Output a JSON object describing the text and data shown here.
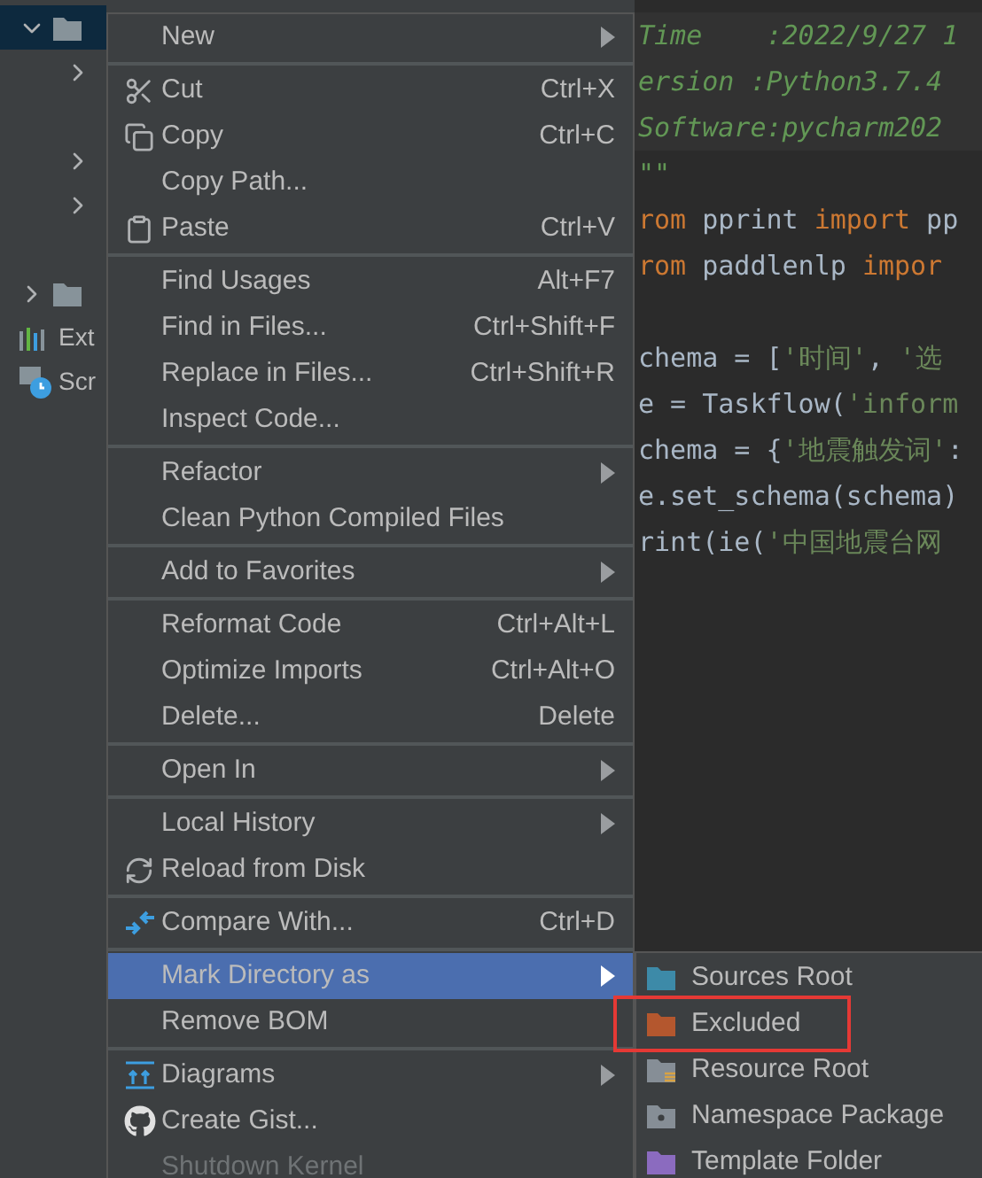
{
  "tree": [
    {
      "kind": "folder",
      "expanded": true,
      "selected": true
    },
    {
      "kind": "chevron",
      "expanded": false,
      "selected": false
    },
    {
      "kind": "blank"
    },
    {
      "kind": "chevron",
      "expanded": false,
      "selected": false
    },
    {
      "kind": "chevron",
      "expanded": false,
      "selected": false
    },
    {
      "kind": "blank"
    },
    {
      "kind": "folder",
      "expanded": false,
      "selected": false
    },
    {
      "kind": "libraries",
      "selected": false,
      "label": "Ext"
    },
    {
      "kind": "scratches",
      "selected": false,
      "label": "Scr"
    }
  ],
  "menu": [
    [
      {
        "label": "New",
        "submenu": true,
        "kind": "plain",
        "selected": false,
        "disabled": false
      }
    ],
    [
      {
        "label": "Cut",
        "shortcut": "Ctrl+X",
        "submenu": false,
        "kind": "cut",
        "selected": false,
        "disabled": false
      },
      {
        "label": "Copy",
        "shortcut": "Ctrl+C",
        "submenu": false,
        "kind": "copy",
        "selected": false,
        "disabled": false
      },
      {
        "label": "Copy Path...",
        "submenu": false,
        "kind": "plain",
        "selected": false,
        "disabled": false
      },
      {
        "label": "Paste",
        "shortcut": "Ctrl+V",
        "submenu": false,
        "kind": "paste",
        "selected": false,
        "disabled": false
      }
    ],
    [
      {
        "label": "Find Usages",
        "shortcut": "Alt+F7",
        "submenu": false,
        "kind": "plain",
        "selected": false,
        "disabled": false
      },
      {
        "label": "Find in Files...",
        "shortcut": "Ctrl+Shift+F",
        "submenu": false,
        "kind": "plain",
        "selected": false,
        "disabled": false
      },
      {
        "label": "Replace in Files...",
        "shortcut": "Ctrl+Shift+R",
        "submenu": false,
        "kind": "plain",
        "selected": false,
        "disabled": false
      },
      {
        "label": "Inspect Code...",
        "submenu": false,
        "kind": "plain",
        "selected": false,
        "disabled": false
      }
    ],
    [
      {
        "label": "Refactor",
        "submenu": true,
        "kind": "plain",
        "selected": false,
        "disabled": false
      },
      {
        "label": "Clean Python Compiled Files",
        "submenu": false,
        "kind": "plain",
        "selected": false,
        "disabled": false
      }
    ],
    [
      {
        "label": "Add to Favorites",
        "submenu": true,
        "kind": "plain",
        "selected": false,
        "disabled": false
      }
    ],
    [
      {
        "label": "Reformat Code",
        "shortcut": "Ctrl+Alt+L",
        "submenu": false,
        "kind": "plain",
        "selected": false,
        "disabled": false
      },
      {
        "label": "Optimize Imports",
        "shortcut": "Ctrl+Alt+O",
        "submenu": false,
        "kind": "plain",
        "selected": false,
        "disabled": false
      },
      {
        "label": "Delete...",
        "shortcut": "Delete",
        "submenu": false,
        "kind": "plain",
        "selected": false,
        "disabled": false
      }
    ],
    [
      {
        "label": "Open In",
        "submenu": true,
        "kind": "plain",
        "selected": false,
        "disabled": false
      }
    ],
    [
      {
        "label": "Local History",
        "submenu": true,
        "kind": "plain",
        "selected": false,
        "disabled": false
      },
      {
        "label": "Reload from Disk",
        "submenu": false,
        "kind": "reload",
        "selected": false,
        "disabled": false
      }
    ],
    [
      {
        "label": "Compare With...",
        "shortcut": "Ctrl+D",
        "submenu": false,
        "kind": "compare",
        "selected": false,
        "disabled": false
      }
    ],
    [
      {
        "label": "Mark Directory as",
        "submenu": true,
        "kind": "plain",
        "selected": true,
        "disabled": false
      },
      {
        "label": "Remove BOM",
        "submenu": false,
        "kind": "plain",
        "selected": false,
        "disabled": false
      }
    ],
    [
      {
        "label": "Diagrams",
        "submenu": true,
        "kind": "diagrams",
        "selected": false,
        "disabled": false
      },
      {
        "label": "Create Gist...",
        "submenu": false,
        "kind": "github",
        "selected": false,
        "disabled": false
      },
      {
        "label": "Shutdown Kernel",
        "submenu": false,
        "kind": "plain",
        "selected": false,
        "disabled": true
      }
    ]
  ],
  "submenu": [
    {
      "label": "Sources Root",
      "kind": "folder",
      "color": "#3d8aa8",
      "highlighted": false
    },
    {
      "label": "Excluded",
      "kind": "folder",
      "color": "#b4572e",
      "highlighted": true
    },
    {
      "label": "Resource Root",
      "kind": "resource",
      "color": "#868e96",
      "highlighted": false
    },
    {
      "label": "Namespace Package",
      "kind": "namespace",
      "color": "#868e96",
      "highlighted": false
    },
    {
      "label": "Template Folder",
      "kind": "folder",
      "color": "#8b6bbf",
      "highlighted": false
    }
  ],
  "editor": [
    [
      {
        "kind": "doc",
        "text": "Time    :2022/9/27 1"
      }
    ],
    [
      {
        "kind": "doc",
        "text": "ersion :Python3.7.4"
      }
    ],
    [
      {
        "kind": "doc",
        "text": "Software:pycharm202"
      }
    ],
    [
      {
        "kind": "doc",
        "text": "\"\""
      }
    ],
    [
      {
        "kind": "keyword",
        "text": "rom"
      },
      {
        "kind": "plain",
        "text": " pprint "
      },
      {
        "kind": "keyword",
        "text": "import"
      },
      {
        "kind": "plain",
        "text": " pp"
      }
    ],
    [
      {
        "kind": "keyword",
        "text": "rom"
      },
      {
        "kind": "plain",
        "text": " paddlenlp "
      },
      {
        "kind": "keyword",
        "text": "impor"
      }
    ],
    [
      {
        "kind": "blank"
      }
    ],
    [
      {
        "kind": "plain",
        "text": "chema = ["
      },
      {
        "kind": "string",
        "text": "'时间'"
      },
      {
        "kind": "plain",
        "text": ", "
      },
      {
        "kind": "string",
        "text": "'选"
      }
    ],
    [
      {
        "kind": "plain",
        "text": "e = Taskflow("
      },
      {
        "kind": "string",
        "text": "'inform"
      }
    ],
    [
      {
        "kind": "plain",
        "text": "chema = {"
      },
      {
        "kind": "string",
        "text": "'地震触发词'"
      },
      {
        "kind": "plain",
        "text": ":"
      }
    ],
    [
      {
        "kind": "plain",
        "text": "e.set_schema(schema)"
      }
    ],
    [
      {
        "kind": "plain",
        "text": "rint(ie("
      },
      {
        "kind": "string",
        "text": "'中国地震台网"
      }
    ]
  ]
}
